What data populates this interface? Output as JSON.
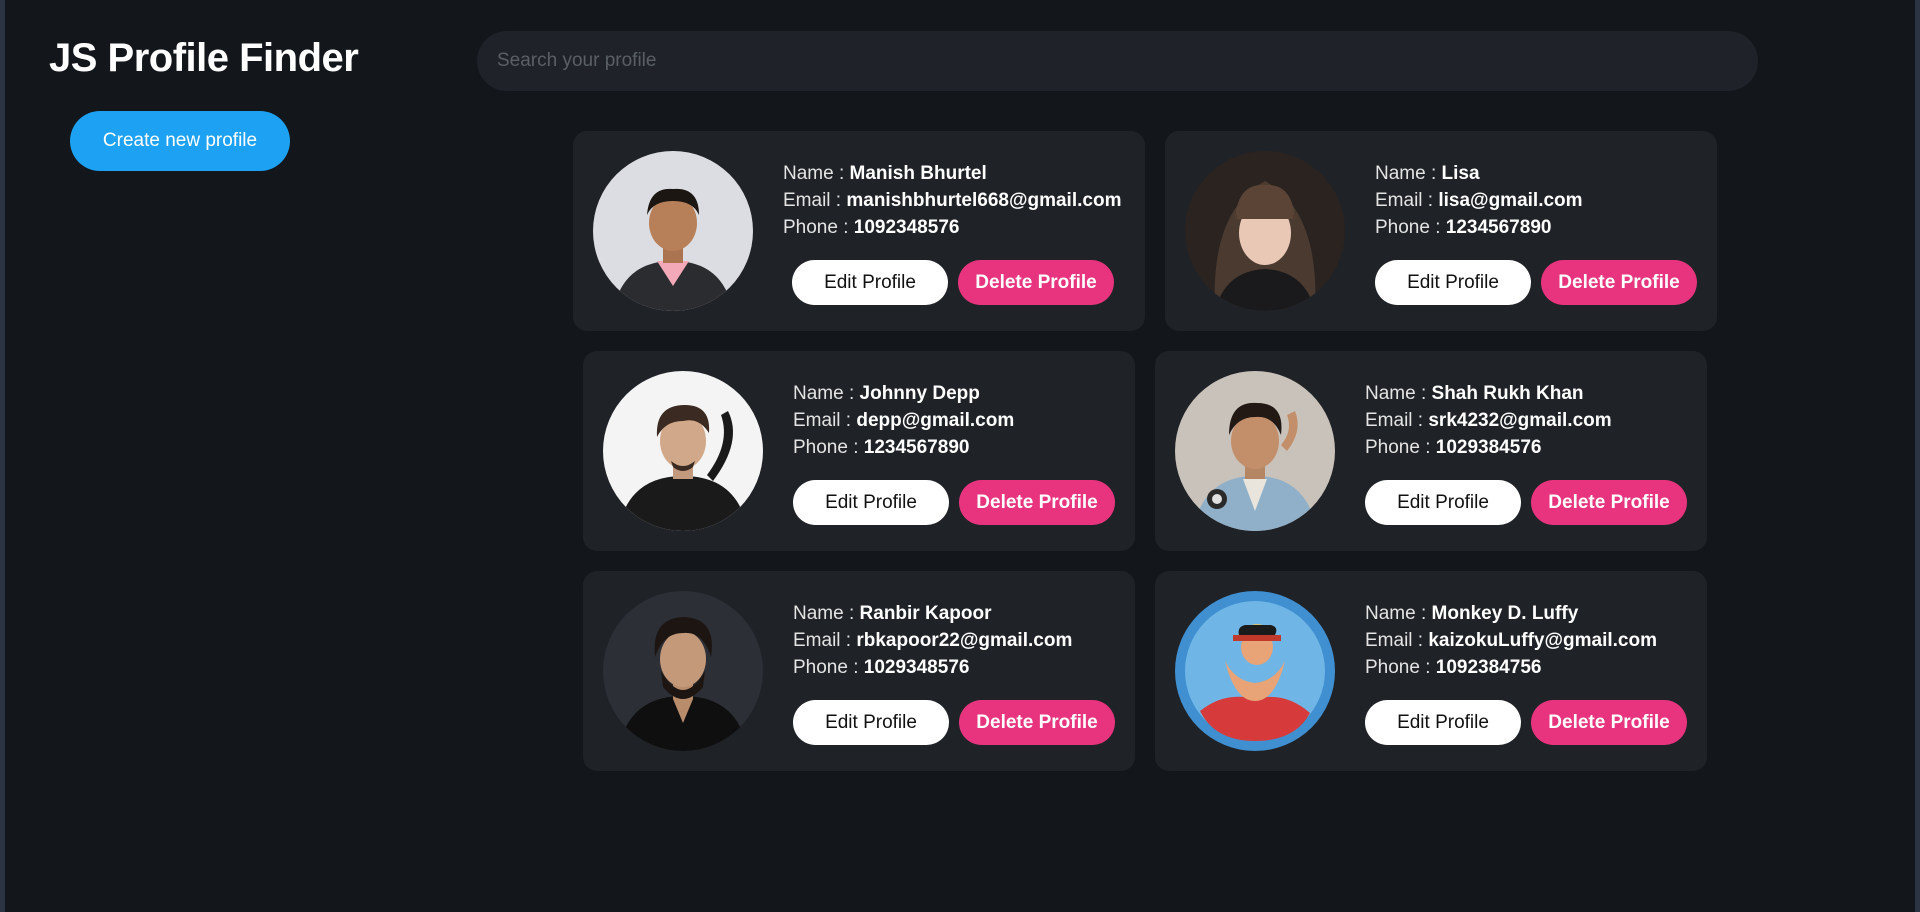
{
  "app": {
    "title": "JS Profile Finder",
    "create_button": "Create new profile",
    "search_placeholder": "Search your profile"
  },
  "labels": {
    "name": "Name : ",
    "email": "Email : ",
    "phone": "Phone : ",
    "edit": "Edit Profile",
    "delete": "Delete Profile"
  },
  "colors": {
    "background": "#13161b",
    "card": "#1f2227",
    "primary_button": "#1da1f2",
    "delete_button": "#e8347e",
    "edit_button": "#ffffff"
  },
  "profiles": [
    {
      "name": "Manish Bhurtel",
      "email": "manishbhurtel668@gmail.com",
      "phone": "1092348576"
    },
    {
      "name": "Lisa",
      "email": "lisa@gmail.com",
      "phone": "1234567890"
    },
    {
      "name": "Johnny Depp",
      "email": "depp@gmail.com",
      "phone": "1234567890"
    },
    {
      "name": "Shah Rukh Khan",
      "email": "srk4232@gmail.com",
      "phone": "1029384576"
    },
    {
      "name": "Ranbir Kapoor",
      "email": "rbkapoor22@gmail.com",
      "phone": "1029348576"
    },
    {
      "name": "Monkey D. Luffy",
      "email": "kaizokuLuffy@gmail.com",
      "phone": "1092384756"
    }
  ]
}
